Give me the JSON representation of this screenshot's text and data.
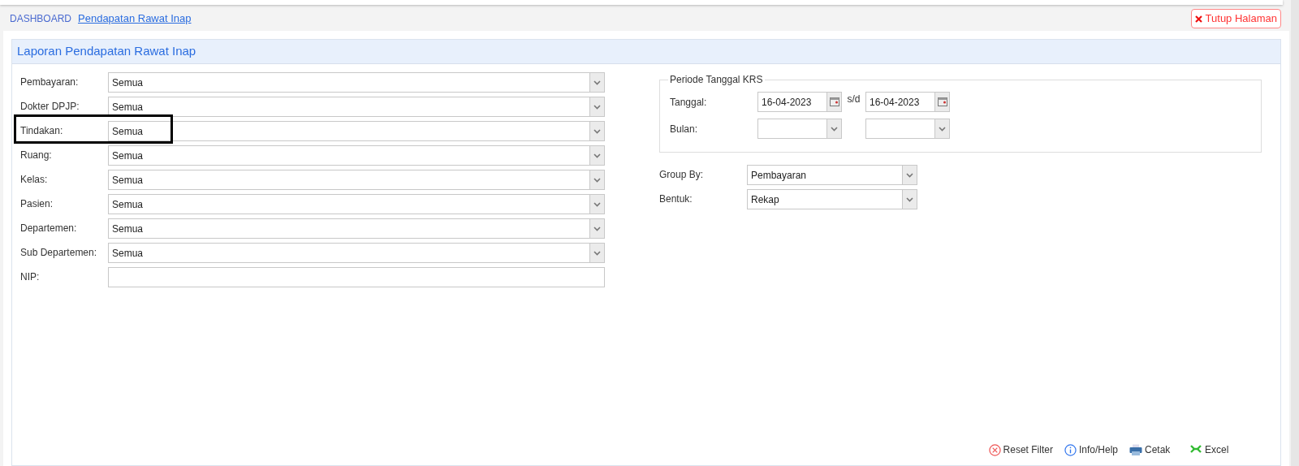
{
  "breadcrumb": [
    {
      "label": "DASHBOARD",
      "selected": false
    },
    {
      "label": "Pendapatan Rawat Inap",
      "selected": true
    }
  ],
  "close_button": "Tutup Halaman",
  "panel": {
    "title": "Laporan Pendapatan Rawat Inap",
    "filters": [
      {
        "label": "Pembayaran:",
        "kind": "select",
        "value": "Semua",
        "highlighted": false
      },
      {
        "label": "Dokter DPJP:",
        "kind": "select",
        "value": "Semua",
        "highlighted": false
      },
      {
        "label": "Tindakan:",
        "kind": "select",
        "value": "Semua",
        "highlighted": true
      },
      {
        "label": "Ruang:",
        "kind": "select",
        "value": "Semua",
        "highlighted": false
      },
      {
        "label": "Kelas:",
        "kind": "select",
        "value": "Semua",
        "highlighted": false
      },
      {
        "label": "Pasien:",
        "kind": "select",
        "value": "Semua",
        "highlighted": false
      },
      {
        "label": "Departemen:",
        "kind": "select",
        "value": "Semua",
        "highlighted": false
      },
      {
        "label": "Sub Departemen:",
        "kind": "select",
        "value": "Semua",
        "highlighted": false
      },
      {
        "label": "NIP:",
        "kind": "text",
        "highlighted": false
      }
    ],
    "periode": {
      "legend": "Periode Tanggal KRS",
      "tanggal_label": "Tanggal:",
      "from": "16-04-2023",
      "separator": "s/d",
      "to": "16-04-2023",
      "bulan_label": "Bulan:"
    },
    "group_by": {
      "label": "Group By:",
      "value": "Pembayaran"
    },
    "bentuk": {
      "label": "Bentuk:",
      "value": "Rekap"
    },
    "actions": [
      {
        "kind": "reset",
        "label": "Reset Filter"
      },
      {
        "kind": "info",
        "label": "Info/Help"
      },
      {
        "kind": "print",
        "label": "Cetak"
      },
      {
        "kind": "excel",
        "label": "Excel"
      }
    ]
  }
}
